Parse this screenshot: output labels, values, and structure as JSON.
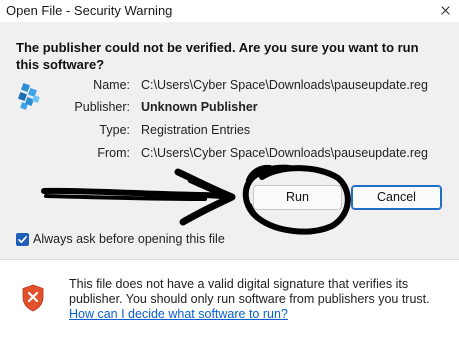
{
  "window": {
    "title": "Open File - Security Warning"
  },
  "prompt": {
    "question": "The publisher could not be verified.  Are you sure you want to run this software?"
  },
  "details": {
    "name_label": "Name:",
    "name_value": "C:\\Users\\Cyber Space\\Downloads\\pauseupdate.reg",
    "publisher_label": "Publisher:",
    "publisher_value": "Unknown Publisher",
    "type_label": "Type:",
    "type_value": "Registration Entries",
    "from_label": "From:",
    "from_value": "C:\\Users\\Cyber Space\\Downloads\\pauseupdate.reg"
  },
  "buttons": {
    "run_label": "Run",
    "cancel_label": "Cancel"
  },
  "options": {
    "always_ask_label": "Always ask before opening this file",
    "always_ask_checked": true
  },
  "warning": {
    "text": "This file does not have a valid digital signature that verifies its publisher.  You should only run software from publishers you trust.",
    "link_text": "How can I decide what software to run?"
  },
  "icons": {
    "file_icon": "registry-file-icon",
    "shield_icon": "shield-warning-icon",
    "close_icon": "close-icon",
    "check_icon": "checkmark-icon"
  },
  "colors": {
    "accent": "#1f5fb8",
    "link": "#0b5fd1",
    "shield": "#e2502c",
    "annotation_ink": "#000000"
  }
}
